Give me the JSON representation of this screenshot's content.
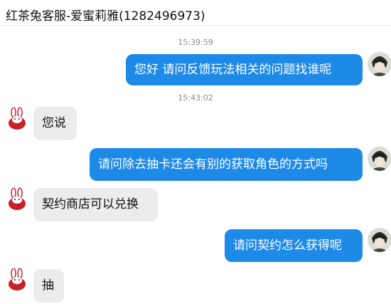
{
  "window": {
    "title": "红茶兔客服-爱蜜莉雅(1282496973)"
  },
  "messages": [
    {
      "type": "time",
      "text": "15:39:59"
    },
    {
      "type": "out",
      "text": "您好 请问反馈玩法相关的问题找谁呢",
      "avatar": "user-avatar"
    },
    {
      "type": "time",
      "text": "15:43:02"
    },
    {
      "type": "in",
      "text": "您说",
      "avatar": "bunny-avatar"
    },
    {
      "type": "out",
      "text": "请问除去抽卡还会有别的获取角色的方式吗",
      "avatar": "user-avatar"
    },
    {
      "type": "in",
      "text": "契约商店可以兑换",
      "avatar": "bunny-avatar"
    },
    {
      "type": "out",
      "text": "请问契约怎么获得呢",
      "avatar": "user-avatar"
    },
    {
      "type": "in",
      "text": "抽",
      "avatar": "bunny-avatar"
    }
  ],
  "colors": {
    "outgoing_bubble": "#1e8ae8",
    "incoming_bubble": "#ececec",
    "timestamp": "#8a8a8a"
  }
}
